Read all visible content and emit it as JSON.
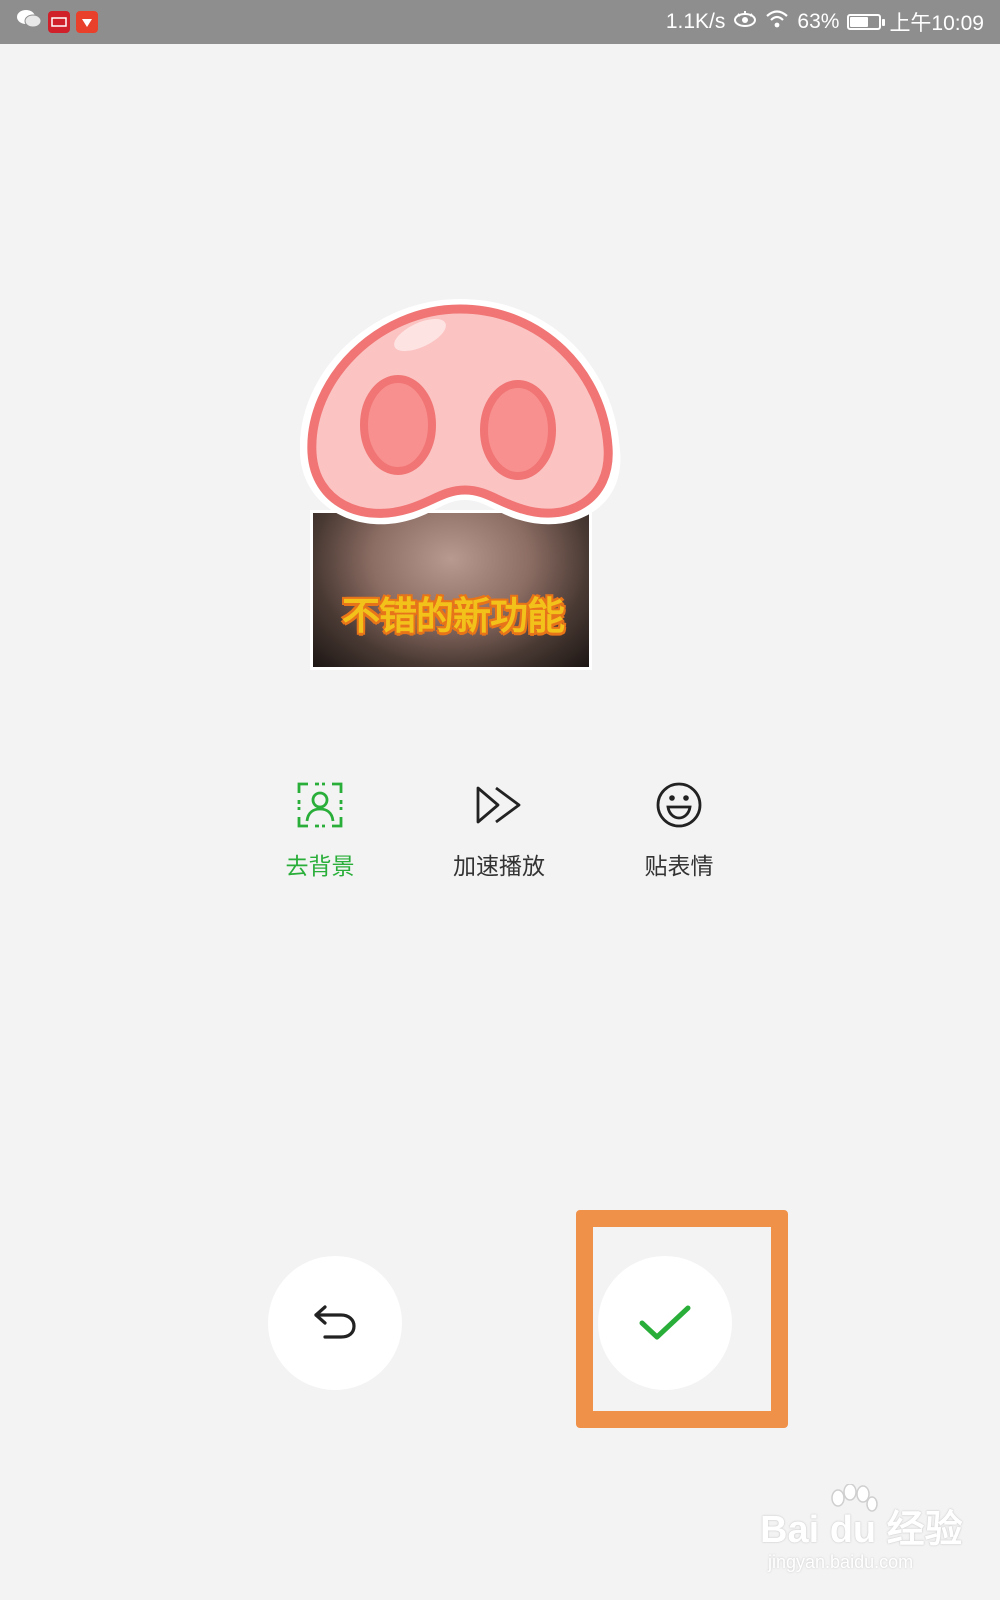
{
  "status_bar": {
    "network_speed": "1.1K/s",
    "battery_percent": "63%",
    "battery_level": 0.63,
    "time": "上午10:09",
    "app_icons": [
      "wechat-icon",
      "tmall-icon",
      "taobao-icon"
    ]
  },
  "sticker": {
    "caption": "不错的新功能"
  },
  "tools": [
    {
      "label": "去背景",
      "icon": "person-frame-icon",
      "active": true
    },
    {
      "label": "加速播放",
      "icon": "fast-forward-icon",
      "active": false
    },
    {
      "label": "贴表情",
      "icon": "smiley-icon",
      "active": false
    }
  ],
  "actions": {
    "undo_icon": "undo-arrow-icon",
    "confirm_icon": "checkmark-icon"
  },
  "watermark": {
    "logo": "Bai du 经验",
    "url": "jingyan.baidu.com"
  },
  "colors": {
    "accent_green": "#2aae3a",
    "highlight_orange": "#f0914a",
    "status_bar": "#8e8e8e",
    "background": "#f3f3f3"
  }
}
